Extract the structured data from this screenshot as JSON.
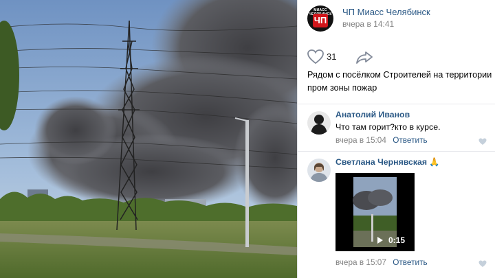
{
  "post": {
    "group_name": "ЧП Миасс Челябинск",
    "avatar_caption": "МИАСС ЧЕЛЯБИНСК",
    "avatar_logo": "ЧП",
    "time": "вчера в 14:41",
    "likes": "31",
    "text": "Рядом с посёлком Строителей на территории пром зоны пожар"
  },
  "comments": [
    {
      "author": "Анатолий Иванов",
      "text": "Что там горит?кто в курсе.",
      "time": "вчера в 15:04",
      "reply_label": "Ответить"
    },
    {
      "author": "Светлана Чернявская 🙏",
      "video_duration": "0:15",
      "time": "вчера в 15:07",
      "reply_label": "Ответить"
    }
  ],
  "colors": {
    "link": "#2a5885",
    "meta": "#828282",
    "sky": "#7ea0c8",
    "smoke": "#4a4a4e",
    "grass": "#5e8a3a"
  },
  "icons": [
    "heart-icon",
    "share-arrow-icon",
    "small-heart-icon"
  ]
}
